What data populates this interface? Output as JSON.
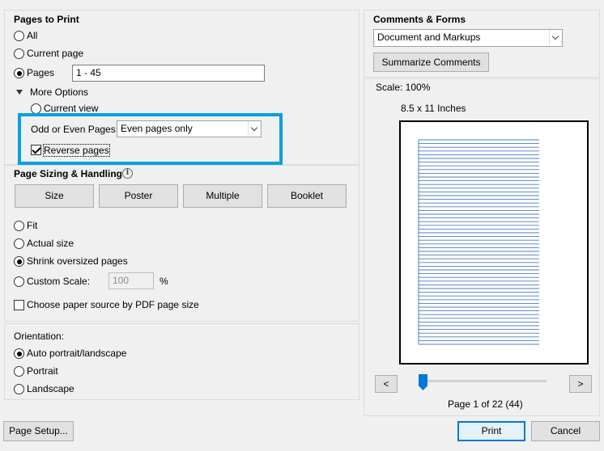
{
  "pages_to_print": {
    "title": "Pages to Print",
    "options": [
      "All",
      "Current page",
      "Pages"
    ],
    "selected": "Pages",
    "pages_value": "1 - 45",
    "more_options_label": "More Options",
    "current_view_label": "Current view",
    "odd_even_label": "Odd or Even Pages:",
    "odd_even_value": "Even pages only",
    "reverse_pages_label": "Reverse pages",
    "reverse_pages_checked": true
  },
  "page_sizing": {
    "title": "Page Sizing & Handling",
    "info_glyph": "i",
    "tabs": [
      "Size",
      "Poster",
      "Multiple",
      "Booklet"
    ],
    "options": [
      "Fit",
      "Actual size",
      "Shrink oversized pages",
      "Custom Scale:"
    ],
    "selected": "Shrink oversized pages",
    "custom_scale_value": "100",
    "percent": "%",
    "paper_source_label": "Choose paper source by PDF page size",
    "paper_source_checked": false
  },
  "orientation": {
    "title": "Orientation:",
    "options": [
      "Auto portrait/landscape",
      "Portrait",
      "Landscape"
    ],
    "selected": "Auto portrait/landscape"
  },
  "comments_forms": {
    "title": "Comments & Forms",
    "value": "Document and Markups",
    "summarize_label": "Summarize Comments"
  },
  "preview": {
    "scale": "Scale: 100%",
    "paper_size": "8.5 x 11 Inches",
    "prev_label": "<",
    "next_label": ">",
    "page_info": "Page 1 of 22 (44)",
    "slider_position": 0.0
  },
  "footer": {
    "page_setup_label": "Page Setup...",
    "print_label": "Print",
    "cancel_label": "Cancel"
  },
  "colors": {
    "highlight": "#0aa0e0",
    "accent": "#0078d7",
    "ruled_lines": "#4a7fc0"
  }
}
